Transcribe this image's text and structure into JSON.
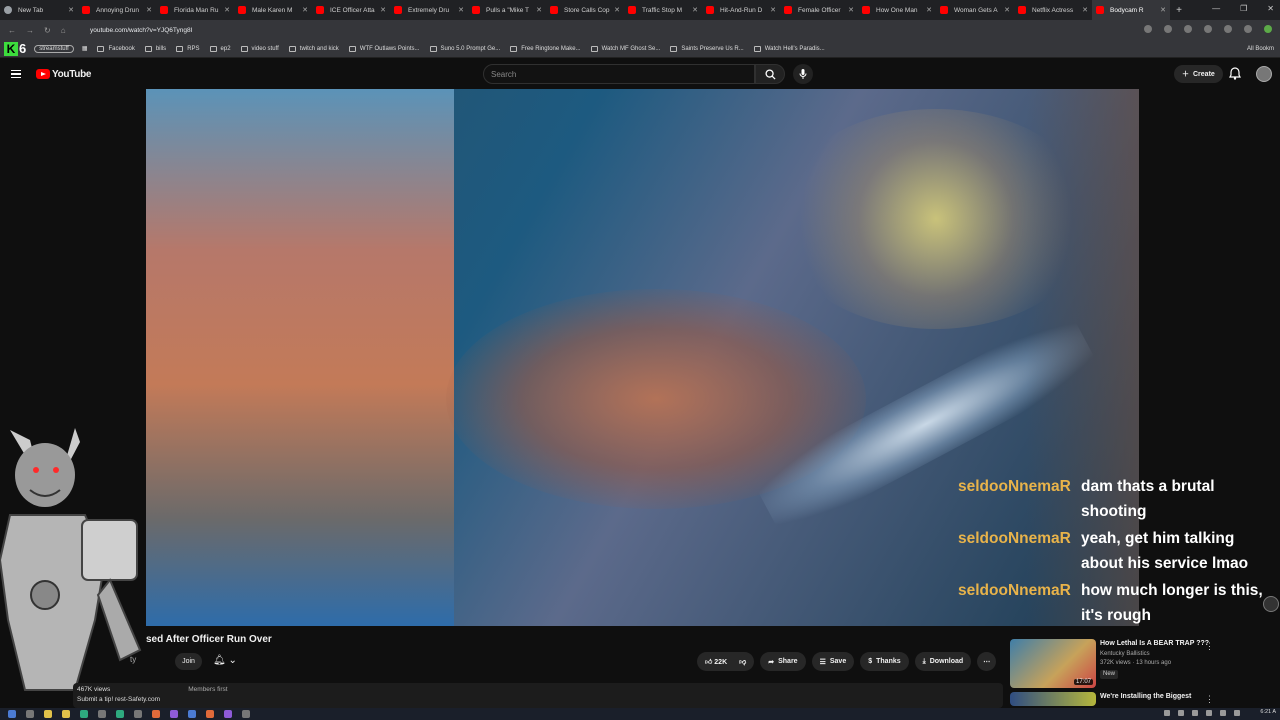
{
  "browser": {
    "tabs": [
      {
        "title": "New Tab",
        "active": false
      },
      {
        "title": "Annoying Drun",
        "active": false
      },
      {
        "title": "Florida Man Ru",
        "active": false
      },
      {
        "title": "Male Karen M",
        "active": false
      },
      {
        "title": "ICE Officer Atta",
        "active": false
      },
      {
        "title": "Extremely Dru",
        "active": false
      },
      {
        "title": "Pulls a \"Mike T",
        "active": false
      },
      {
        "title": "Store Calls Cop",
        "active": false
      },
      {
        "title": "Traffic Stop M",
        "active": false
      },
      {
        "title": "Hit-And-Run D",
        "active": false
      },
      {
        "title": "Female Officer",
        "active": false
      },
      {
        "title": "How One Man",
        "active": false
      },
      {
        "title": "Woman Gets A",
        "active": false
      },
      {
        "title": "Netflix Actress",
        "active": false
      },
      {
        "title": "Bodycam R",
        "active": true
      }
    ],
    "new_tab": "+",
    "url": "youtube.com/watch?v=YJQ6Tyng8I",
    "bookmarks": [
      "Facebook",
      "bills",
      "RPS",
      "ep2",
      "video stuff",
      "twitch and kick",
      "WTF Outlaws Points...",
      "Suno 5.0 Prompt Ge...",
      "Free Ringtone Make...",
      "Watch MF Ghost Se...",
      "Saints Preserve Us R...",
      "Watch Hell's Paradis..."
    ],
    "bookmark_pill": "streamstuff",
    "k6_letter": "K",
    "k6_number": "6",
    "all_bookmarks": "All Bookm"
  },
  "youtube": {
    "logo": "YouTube",
    "search_placeholder": "Search",
    "create_label": "Create",
    "video_title": "sed After Officer Run Over",
    "channel_fragment": "ty",
    "join_label": "Join",
    "like_count": "22K",
    "share_label": "Share",
    "save_label": "Save",
    "thanks_label": "Thanks",
    "download_label": "Download",
    "description": {
      "views": "467K views",
      "members": "Members first",
      "tip": "Submit a tip!",
      "tip_link": "rest-Safety.com"
    },
    "related": [
      {
        "title": "How Lethal Is A BEAR TRAP ???",
        "channel": "Kentucky Ballistics",
        "meta": "372K views · 13 hours ago",
        "badge": "New",
        "duration": "17:07"
      },
      {
        "title": "We're Installing the Biggest",
        "channel": "",
        "meta": "",
        "badge": "",
        "duration": ""
      }
    ]
  },
  "chat": [
    {
      "user": "seldooNnemaR",
      "text": "dam thats a brutal shooting"
    },
    {
      "user": "seldooNnemaR",
      "text": "yeah, get him talking about his service lmao"
    },
    {
      "user": "seldooNnemaR",
      "text": "how much longer is this, it's rough"
    }
  ],
  "taskbar": {
    "time": "6:21 A"
  },
  "colors": {
    "youtube_red": "#ff0000",
    "chat_user": "#e8b34a",
    "background": "#0f0f0f"
  }
}
